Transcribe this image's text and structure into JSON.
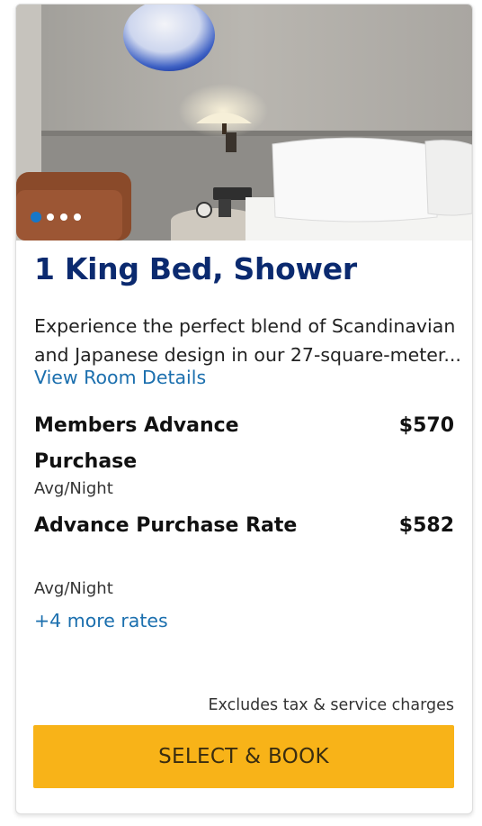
{
  "room": {
    "title": "1 King Bed, Shower",
    "description": "Experience the perfect blend of Scandinavian and Japanese design in our 27-square-meter...",
    "details_link": "View Room Details"
  },
  "carousel": {
    "total": 4,
    "active_index": 0,
    "active_color": "#1677c8"
  },
  "rates": [
    {
      "name": "Members Advance Purchase",
      "price": "$570",
      "unit": "Avg/Night"
    },
    {
      "name": "Advance Purchase Rate",
      "price": "$582",
      "unit": "Avg/Night"
    }
  ],
  "more_rates": "+4 more rates",
  "disclaimer": "Excludes tax & service charges",
  "cta": {
    "label": "SELECT & BOOK",
    "color": "#f8b318"
  },
  "colors": {
    "title": "#0b2a6f",
    "link": "#1b6fae"
  }
}
